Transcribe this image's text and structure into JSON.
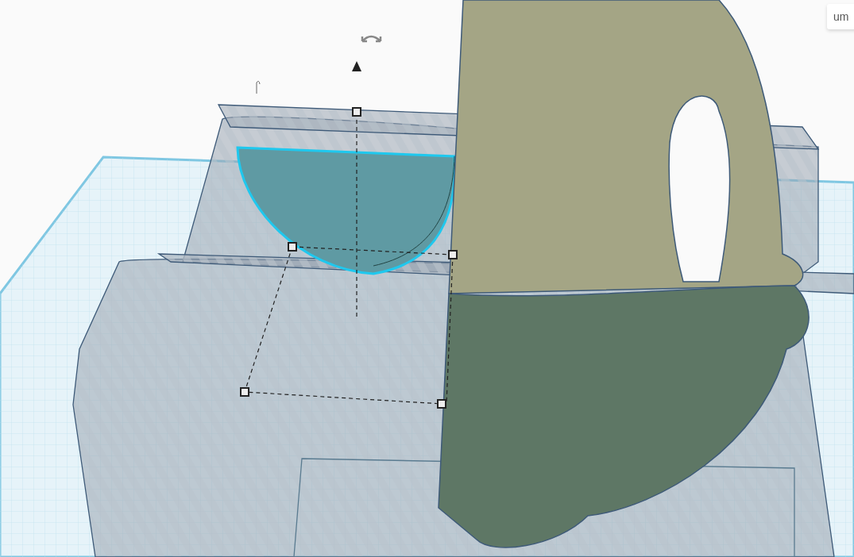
{
  "units_button": {
    "label": "um"
  }
}
